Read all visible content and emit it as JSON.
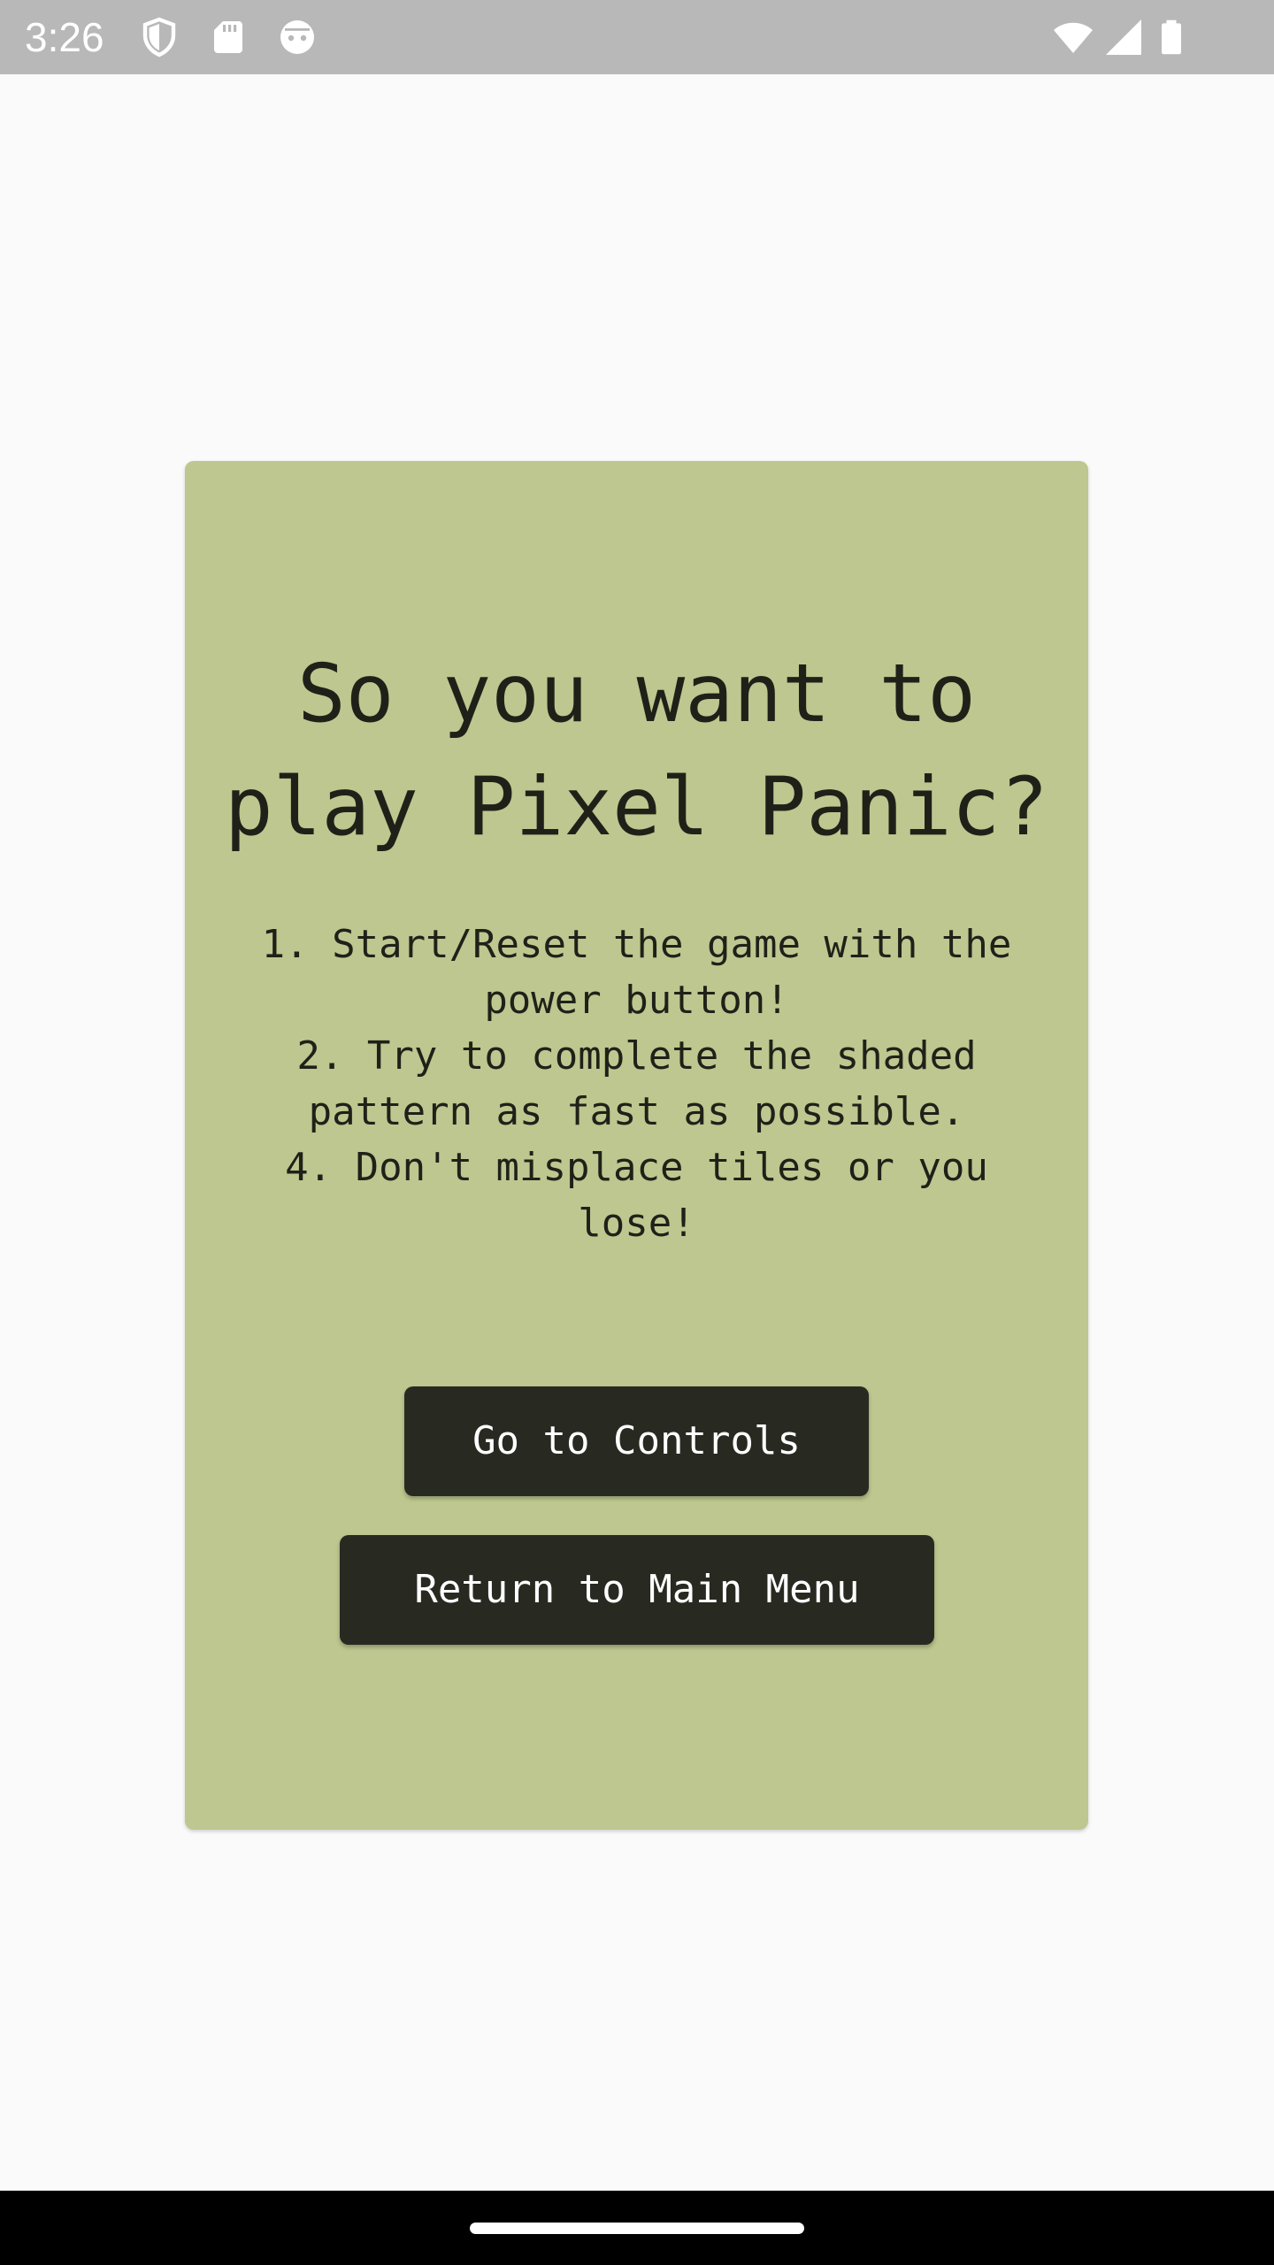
{
  "status_bar": {
    "time": "3:26",
    "left_icons": [
      "shield-icon",
      "sd-card-icon",
      "android-face-icon"
    ],
    "right_icons": [
      "wifi-icon",
      "signal-icon",
      "battery-icon"
    ]
  },
  "card": {
    "title": "So you want to\nplay Pixel Panic?",
    "instructions": [
      "1. Start/Reset the game with the\npower button!",
      "2. Try to complete the shaded\npattern as fast as possible.",
      "4. Don't misplace tiles or you\nlose!"
    ],
    "buttons": {
      "controls_label": "Go to Controls",
      "main_menu_label": "Return to Main Menu"
    }
  },
  "colors": {
    "card_background": "#bdc78f",
    "button_background": "#282a22",
    "page_background": "#fafafa",
    "status_bar_background": "#b8b8b8"
  }
}
